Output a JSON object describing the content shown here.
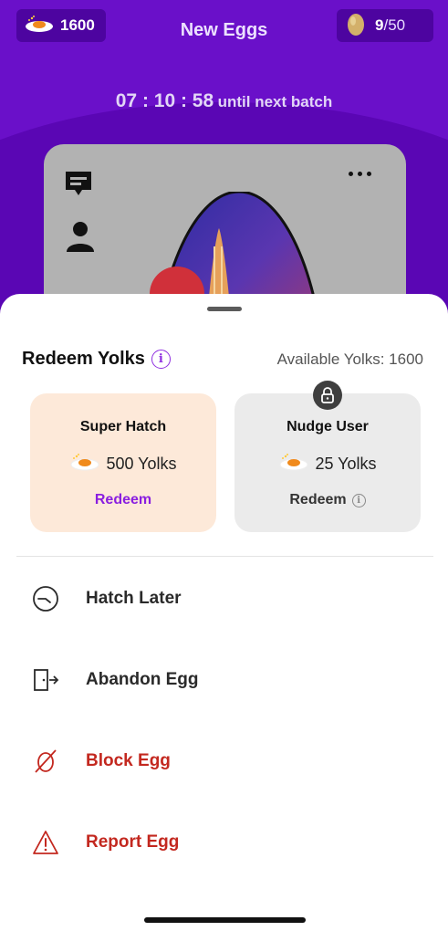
{
  "header": {
    "yolk_balance": "1600",
    "title": "New Eggs",
    "egg_count": "9",
    "egg_total": "/50",
    "timer": "07 : 10 : 58",
    "timer_suffix": "until next batch"
  },
  "sheet": {
    "title": "Redeem Yolks",
    "available": "Available Yolks: 1600",
    "tiles": [
      {
        "title": "Super Hatch",
        "cost": "500 Yolks",
        "action": "Redeem",
        "locked": false
      },
      {
        "title": "Nudge User",
        "cost": "25 Yolks",
        "action": "Redeem",
        "locked": true
      }
    ],
    "actions": [
      {
        "label": "Hatch Later",
        "icon": "clock-icon",
        "color": "#2a2a2a"
      },
      {
        "label": "Abandon Egg",
        "icon": "exit-icon",
        "color": "#2a2a2a"
      },
      {
        "label": "Block Egg",
        "icon": "block-egg-icon",
        "color": "#c3281f"
      },
      {
        "label": "Report Egg",
        "icon": "warning-icon",
        "color": "#c3281f"
      }
    ]
  },
  "colors": {
    "header_purple": "#6a10c9",
    "accent_purple": "#8a1ee0",
    "danger_red": "#c3281f",
    "super_tile_bg": "#fde9d9",
    "nudge_tile_bg": "#ebebeb"
  }
}
